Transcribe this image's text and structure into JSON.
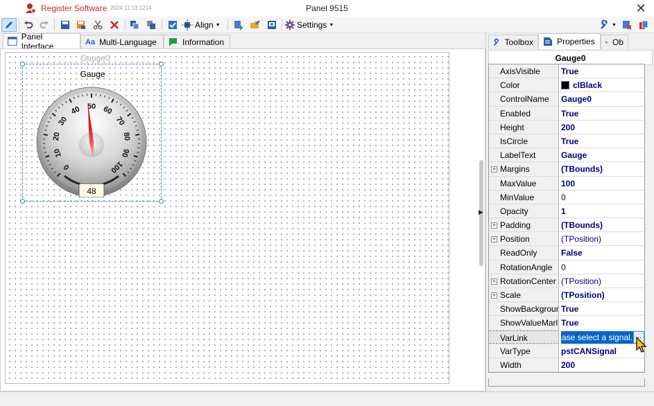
{
  "titlebar": {
    "app_name": "Register Software",
    "version": "2024.11.13.1214",
    "window_title": "Panel 9515",
    "close_glyph": "✕"
  },
  "toolbar": {
    "align_label": "Align",
    "settings_label": "Settings",
    "icons": [
      "pencil-icon",
      "undo-icon",
      "redo-icon",
      "save-icon",
      "save-as-icon",
      "cut-icon",
      "delete-icon",
      "copy-icon",
      "paste-icon",
      "checkbox-icon",
      "align-icon",
      "settings-gear-icon",
      "add-page-icon",
      "open-folder-icon",
      "export-icon",
      "wrench-icon",
      "delete-page-icon",
      "pages-icon"
    ]
  },
  "left_tabs": [
    {
      "label": "Panel Interface",
      "icon": "panel-icon",
      "active": true
    },
    {
      "label": "Multi-Language",
      "icon": "font-aa-icon",
      "active": false
    },
    {
      "label": "Information",
      "icon": "info-flag-icon",
      "active": false
    }
  ],
  "design": {
    "control_name_overlay": "Gauge0",
    "gauge": {
      "label": "Gauge",
      "value": 48,
      "value_display": "48",
      "min": 0,
      "max": 100,
      "tick_labels": [
        "0",
        "10",
        "20",
        "30",
        "40",
        "50",
        "60",
        "70",
        "80",
        "90",
        "100"
      ]
    }
  },
  "right_tabs": [
    {
      "label": "Toolbox",
      "icon": "wrench-icon",
      "active": false
    },
    {
      "label": "Properties",
      "icon": "properties-icon",
      "active": true
    },
    {
      "label": "Ob",
      "icon": "pointer-icon",
      "active": false
    }
  ],
  "properties": {
    "header": "Gauge0",
    "rows": [
      {
        "name": "AxisVisible",
        "value": "True",
        "style": "bold",
        "expandable": false
      },
      {
        "name": "Color",
        "value": "clBlack",
        "style": "bold",
        "expandable": false,
        "swatch": "#000000"
      },
      {
        "name": "ControlName",
        "value": "Gauge0",
        "style": "bold",
        "expandable": false
      },
      {
        "name": "Enabled",
        "value": "True",
        "style": "bold",
        "expandable": false
      },
      {
        "name": "Height",
        "value": "200",
        "style": "bold",
        "expandable": false
      },
      {
        "name": "IsCircle",
        "value": "True",
        "style": "bold",
        "expandable": false
      },
      {
        "name": "LabelText",
        "value": "Gauge",
        "style": "bold",
        "expandable": false
      },
      {
        "name": "Margins",
        "value": "(TBounds)",
        "style": "bold",
        "expandable": true
      },
      {
        "name": "MaxValue",
        "value": "100",
        "style": "bold",
        "expandable": false
      },
      {
        "name": "MinValue",
        "value": "0",
        "style": "normal",
        "expandable": false
      },
      {
        "name": "Opacity",
        "value": "1",
        "style": "bold",
        "expandable": false
      },
      {
        "name": "Padding",
        "value": "(TBounds)",
        "style": "bold",
        "expandable": true
      },
      {
        "name": "Position",
        "value": "(TPosition)",
        "style": "normal",
        "expandable": true
      },
      {
        "name": "ReadOnly",
        "value": "False",
        "style": "bold",
        "expandable": false
      },
      {
        "name": "RotationAngle",
        "value": "0",
        "style": "normal",
        "expandable": false
      },
      {
        "name": "RotationCenter",
        "value": "(TPosition)",
        "style": "normal",
        "expandable": true
      },
      {
        "name": "Scale",
        "value": "(TPosition)",
        "style": "bold",
        "expandable": true
      },
      {
        "name": "ShowBackgrour",
        "value": "True",
        "style": "bold",
        "expandable": false
      },
      {
        "name": "ShowValueMarl",
        "value": "True",
        "style": "bold",
        "expandable": false
      },
      {
        "name": "VarLink",
        "value": "ase select a signal...",
        "style": "edit",
        "expandable": false,
        "active": true
      },
      {
        "name": "VarType",
        "value": "pstCANSignal",
        "style": "bold",
        "expandable": false
      },
      {
        "name": "Width",
        "value": "200",
        "style": "bold",
        "expandable": false
      }
    ],
    "ellipsis_label": "..."
  },
  "colors": {
    "brand_red": "#c0282c",
    "selection_blue": "#3a78c8",
    "value_navy": "#000080",
    "edit_highlight": "#0a64c8"
  }
}
